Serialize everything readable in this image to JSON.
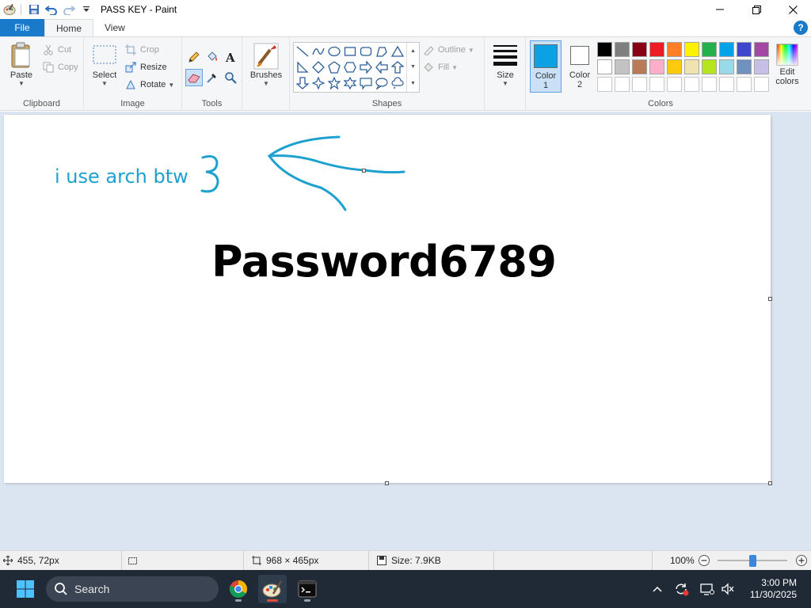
{
  "window": {
    "title": "PASS KEY - Paint"
  },
  "tabs": {
    "file": "File",
    "home": "Home",
    "view": "View"
  },
  "ribbon": {
    "clipboard": {
      "label": "Clipboard",
      "paste": "Paste",
      "cut": "Cut",
      "copy": "Copy"
    },
    "image": {
      "label": "Image",
      "select": "Select",
      "crop": "Crop",
      "resize": "Resize",
      "rotate": "Rotate"
    },
    "tools": {
      "label": "Tools"
    },
    "brushes": {
      "label": "Brushes"
    },
    "shapes": {
      "label": "Shapes",
      "outline": "Outline",
      "fill": "Fill"
    },
    "size": {
      "label": "Size"
    },
    "color1": {
      "label_line1": "Color",
      "label_line2": "1",
      "value": "#0ba1e2"
    },
    "color2": {
      "label_line1": "Color",
      "label_line2": "2",
      "value": "#ffffff"
    },
    "colors": {
      "label": "Colors",
      "edit_line1": "Edit",
      "edit_line2": "colors"
    },
    "palette_row1": [
      "#000000",
      "#7f7f7f",
      "#880015",
      "#ed1c24",
      "#ff7f27",
      "#fff200",
      "#22b14c",
      "#00a2e8",
      "#3f48cc",
      "#a349a4"
    ],
    "palette_row2": [
      "#ffffff",
      "#c3c3c3",
      "#b97a57",
      "#ffaec9",
      "#ffc90e",
      "#efe4b0",
      "#b5e61d",
      "#99d9ea",
      "#7092be",
      "#c8bfe7"
    ]
  },
  "canvas": {
    "text_small": "i use arch btw",
    "text_big": "Password6789",
    "ink_color": "#1ea1cf"
  },
  "status": {
    "cursor": "455, 72px",
    "canvas_size": "968 × 465px",
    "file_size": "Size: 7.9KB",
    "zoom": "100%"
  },
  "taskbar": {
    "search_label": "Search",
    "time": "3:00 PM",
    "date": "11/30/2025"
  }
}
